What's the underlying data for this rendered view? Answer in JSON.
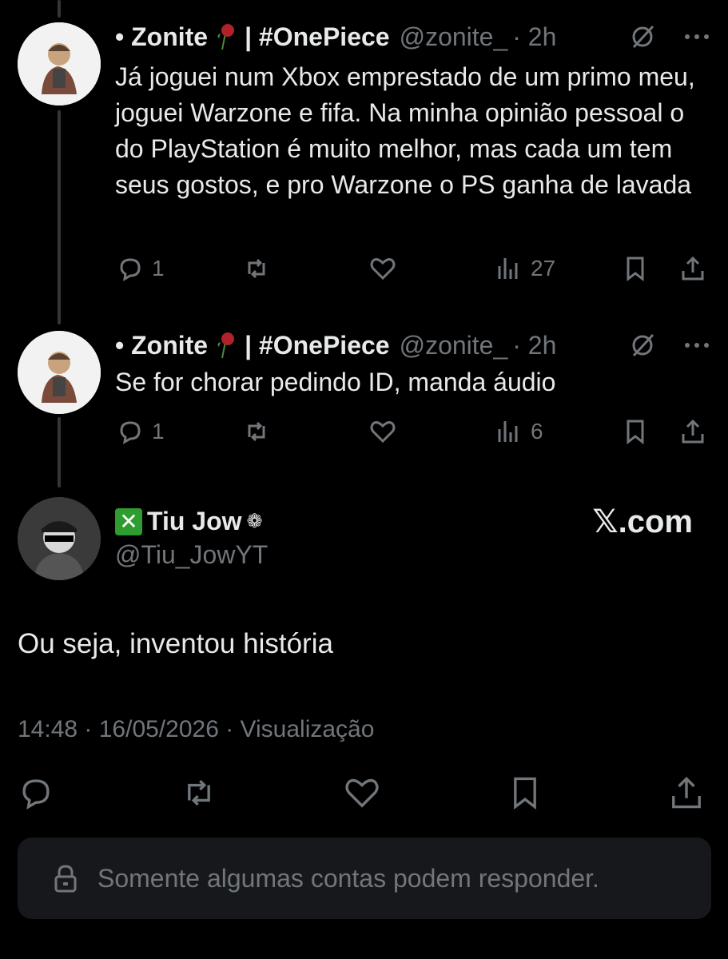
{
  "replies": [
    {
      "name": "• Zonite",
      "name_suffix": "| #OnePiece",
      "handle": "@zonite_",
      "time": "· 2h",
      "text": "Já joguei num Xbox emprestado de um primo meu, joguei Warzone e fifa. Na minha opinião pessoal o do PlayStation é muito melhor, mas cada um tem seus gostos, e pro Warzone o PS ganha de lavada",
      "reply_count": "1",
      "views": "27"
    },
    {
      "name": "• Zonite",
      "name_suffix": "| #OnePiece",
      "handle": "@zonite_",
      "time": "· 2h",
      "text": "Se for chorar pedindo ID, manda áudio",
      "reply_count": "1",
      "views": "6"
    }
  ],
  "main_post": {
    "badge": "✕",
    "name": "Tiu Jow",
    "name_glyph": "❁",
    "handle": "@Tiu_JowYT",
    "watermark": "𝕏.com",
    "text": "Ou seja, inventou história",
    "meta": "14:48 · 16/05/2026 · Visualização"
  },
  "reply_restriction": "Somente algumas contas podem responder.",
  "colors": {
    "background": "#000000",
    "text": "#e7e9ea",
    "muted": "#71767b",
    "panel": "#16181c",
    "xbox_green": "#2f9c2f"
  }
}
